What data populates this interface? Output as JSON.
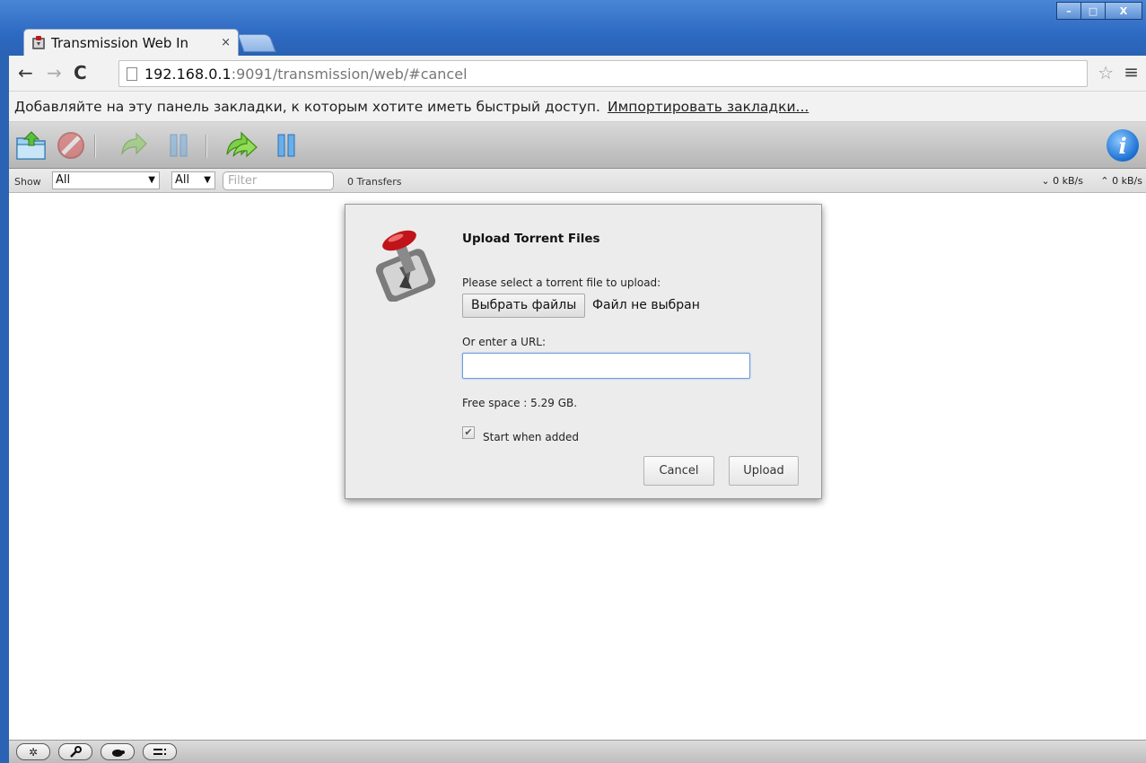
{
  "window": {
    "controls": [
      "–",
      "□",
      "X"
    ]
  },
  "tab": {
    "title": "Transmission Web In",
    "close": "×"
  },
  "nav": {
    "back": "←",
    "forward": "→",
    "reload": "C",
    "url_host": "192.168.0.1",
    "url_rest": ":9091/transmission/web/#cancel",
    "star": "☆",
    "menu": "≡"
  },
  "bookmarks": {
    "hint": "Добавляйте на эту панель закладки, к которым хотите иметь быстрый доступ.",
    "import_link": "Импортировать закладки..."
  },
  "toolbar": {
    "buttons": [
      "open-torrent",
      "remove-torrent",
      "resume-selected",
      "pause-selected",
      "resume-all",
      "pause-all"
    ],
    "info": "i"
  },
  "filterbar": {
    "show_label": "Show",
    "state_select": "All",
    "tracker_select": "All",
    "filter_placeholder": "Filter",
    "transfers": "0 Transfers",
    "down_speed": "0 kB/s",
    "up_speed": "0 kB/s"
  },
  "bottom_bar": {
    "buttons": [
      "settings",
      "preferences",
      "turtle",
      "compact"
    ]
  },
  "dialog": {
    "title": "Upload Torrent Files",
    "prompt": "Please select a torrent file to upload:",
    "choose_files": "Выбрать файлы",
    "file_status": "Файл не выбран",
    "url_label": "Or enter a URL:",
    "url_value": "",
    "free_space": "Free space : 5.29 GB.",
    "start_when_added": "Start when added",
    "start_checked": true,
    "cancel": "Cancel",
    "upload": "Upload"
  },
  "colors": {
    "window_frame": "#2a62b4",
    "dialog_bg": "#ececec",
    "url_focus": "#6f9bd8"
  }
}
